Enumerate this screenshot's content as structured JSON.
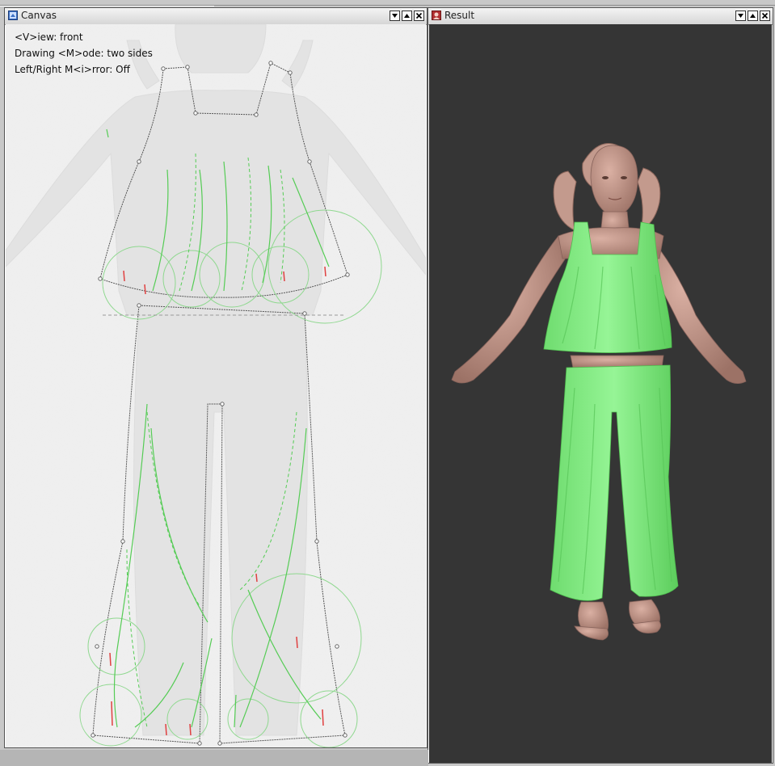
{
  "windows": {
    "canvas": {
      "title": "Canvas",
      "icon": "canvas-window-icon",
      "overlay": {
        "view": "<V>iew: front",
        "drawing_mode": "Drawing <M>ode: two sides",
        "mirror": "Left/Right M<i>rror: Off"
      }
    },
    "result": {
      "title": "Result",
      "icon": "result-window-icon"
    }
  },
  "colors": {
    "canvas_background": "#efefef",
    "result_background": "#353535",
    "garment_green": "#86ee86",
    "skin": "#c69a8e",
    "stroke_green": "#55cc55",
    "outline_dark": "#555555",
    "marker_red": "#e04040"
  }
}
